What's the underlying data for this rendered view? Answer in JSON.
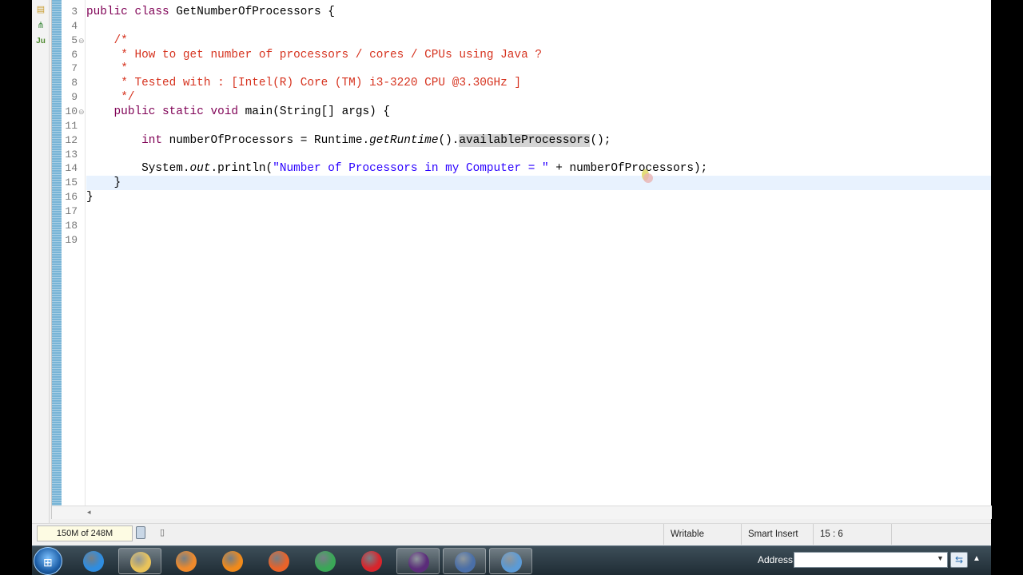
{
  "editor": {
    "lines": [
      {
        "num": "3",
        "fold": "",
        "current": false,
        "tokens": [
          {
            "t": "public",
            "c": "kw"
          },
          {
            "t": " "
          },
          {
            "t": "class",
            "c": "kw"
          },
          {
            "t": " GetNumberOfProcessors {"
          }
        ]
      },
      {
        "num": "4",
        "fold": "",
        "current": false,
        "tokens": []
      },
      {
        "num": "5",
        "fold": "⊖",
        "current": false,
        "tokens": [
          {
            "t": "    "
          },
          {
            "t": "/*",
            "c": "cmt"
          }
        ]
      },
      {
        "num": "6",
        "fold": "",
        "current": false,
        "tokens": [
          {
            "t": "     "
          },
          {
            "t": "* How to get number of processors / cores / CPUs using Java ?",
            "c": "cmt"
          }
        ]
      },
      {
        "num": "7",
        "fold": "",
        "current": false,
        "tokens": [
          {
            "t": "     "
          },
          {
            "t": "*",
            "c": "cmt"
          }
        ]
      },
      {
        "num": "8",
        "fold": "",
        "current": false,
        "tokens": [
          {
            "t": "     "
          },
          {
            "t": "* Tested with : [Intel(R) Core (TM) i3-3220 CPU @3.30GHz ]",
            "c": "cmt"
          }
        ]
      },
      {
        "num": "9",
        "fold": "",
        "current": false,
        "tokens": [
          {
            "t": "     "
          },
          {
            "t": "*/",
            "c": "cmt"
          }
        ]
      },
      {
        "num": "10",
        "fold": "⊖",
        "current": false,
        "tokens": [
          {
            "t": "    "
          },
          {
            "t": "public",
            "c": "kw"
          },
          {
            "t": " "
          },
          {
            "t": "static",
            "c": "kw"
          },
          {
            "t": " "
          },
          {
            "t": "void",
            "c": "kw"
          },
          {
            "t": " main(String[] args) {"
          }
        ]
      },
      {
        "num": "11",
        "fold": "",
        "current": false,
        "tokens": []
      },
      {
        "num": "12",
        "fold": "",
        "current": false,
        "tokens": [
          {
            "t": "        "
          },
          {
            "t": "int",
            "c": "kw"
          },
          {
            "t": " numberOfProcessors = Runtime."
          },
          {
            "t": "getRuntime",
            "c": "it"
          },
          {
            "t": "()."
          },
          {
            "t": "availableProcessors",
            "c": "occ"
          },
          {
            "t": "();"
          }
        ]
      },
      {
        "num": "13",
        "fold": "",
        "current": false,
        "tokens": []
      },
      {
        "num": "14",
        "fold": "",
        "current": false,
        "tokens": [
          {
            "t": "        System."
          },
          {
            "t": "out",
            "c": "it"
          },
          {
            "t": ".println("
          },
          {
            "t": "\"Number of Processors in my Computer = \"",
            "c": "str"
          },
          {
            "t": " + numberOfProcessors);"
          }
        ]
      },
      {
        "num": "15",
        "fold": "",
        "current": true,
        "tokens": [
          {
            "t": "    }"
          }
        ]
      },
      {
        "num": "16",
        "fold": "",
        "current": false,
        "tokens": [
          {
            "t": "}"
          }
        ]
      },
      {
        "num": "17",
        "fold": "",
        "current": false,
        "tokens": []
      },
      {
        "num": "18",
        "fold": "",
        "current": false,
        "tokens": []
      },
      {
        "num": "19",
        "fold": "",
        "current": false,
        "tokens": []
      }
    ]
  },
  "trim": {
    "icons": [
      "package-explorer-icon",
      "hierarchy-icon",
      "junit-icon"
    ],
    "junit_label": "Ju"
  },
  "statusbar": {
    "heap": "150M of 248M",
    "writable": "Writable",
    "insert_mode": "Smart Insert",
    "position": "15 : 6"
  },
  "taskbar": {
    "apps": [
      {
        "name": "internet-explorer-icon",
        "color": "#2f8de0"
      },
      {
        "name": "file-explorer-icon",
        "color": "#e9c35a"
      },
      {
        "name": "media-player-icon",
        "color": "#ef8a2c"
      },
      {
        "name": "vlc-icon",
        "color": "#f08a1b"
      },
      {
        "name": "firefox-icon",
        "color": "#e8632a"
      },
      {
        "name": "chrome-icon",
        "color": "#3aa757"
      },
      {
        "name": "airtel-icon",
        "color": "#d8252c"
      },
      {
        "name": "eclipse-java-ee-icon",
        "color": "#5b2c7a"
      },
      {
        "name": "video-editor-icon",
        "color": "#4a6fa8"
      },
      {
        "name": "remote-desktop-icon",
        "color": "#5c9bd6"
      }
    ],
    "address_label": "Address",
    "address_value": ""
  },
  "colors": {
    "keyword": "#7f0055",
    "comment": "#d6331f",
    "string": "#2a00ff",
    "current_line": "#e8f2fe"
  }
}
